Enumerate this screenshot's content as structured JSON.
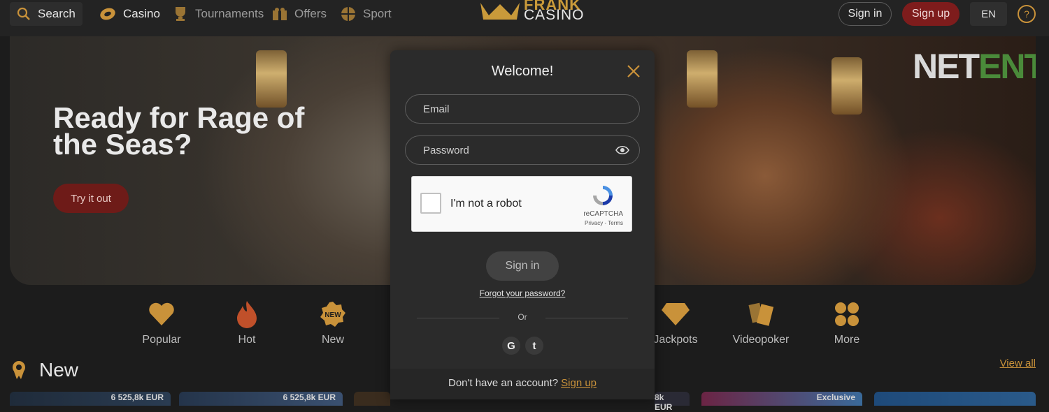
{
  "topbar": {
    "search_label": "Search",
    "nav": [
      {
        "label": "Casino",
        "icon": "casino-chip-icon",
        "active": true
      },
      {
        "label": "Tournaments",
        "icon": "trophy-icon",
        "active": false
      },
      {
        "label": "Offers",
        "icon": "gift-icon",
        "active": false
      },
      {
        "label": "Sport",
        "icon": "ball-icon",
        "active": false
      }
    ],
    "logo_word1": "FRANK",
    "logo_word2": "CASINO",
    "signin_label": "Sign in",
    "signup_label": "Sign up",
    "lang_label": "EN",
    "help_label": "?"
  },
  "hero": {
    "headline": "Ready for Rage of the Seas?",
    "cta_label": "Try it out",
    "provider_a": "NET",
    "provider_b": "ENT"
  },
  "categories": [
    {
      "label": "Popular",
      "icon": "heart-icon"
    },
    {
      "label": "Hot",
      "icon": "flame-icon"
    },
    {
      "label": "New",
      "icon": "new-badge-icon"
    },
    {
      "label": "Jackpots",
      "icon": "diamond-icon"
    },
    {
      "label": "Videopoker",
      "icon": "cards-icon"
    },
    {
      "label": "More",
      "icon": "grid-dots-icon"
    }
  ],
  "new_badge_text": "NEW",
  "new_section": {
    "title": "New",
    "view_all": "View all",
    "prices": [
      "6 525,8k EUR",
      "6 525,8k EUR",
      "8k EUR",
      "Exclusive"
    ]
  },
  "modal": {
    "title": "Welcome!",
    "email_placeholder": "Email",
    "password_placeholder": "Password",
    "captcha_text": "I'm not a robot",
    "captcha_brand": "reCAPTCHA",
    "captcha_terms": "Privacy - Terms",
    "signin_label": "Sign in",
    "forgot_label": "Forgot your password?",
    "or_label": "Or",
    "social": [
      "G",
      "t"
    ],
    "footer_text": "Don't have an account?",
    "footer_link": "Sign up"
  },
  "colors": {
    "accent": "#c9923a",
    "signup_red": "#7e1c1c",
    "background": "#1c1c1c"
  }
}
